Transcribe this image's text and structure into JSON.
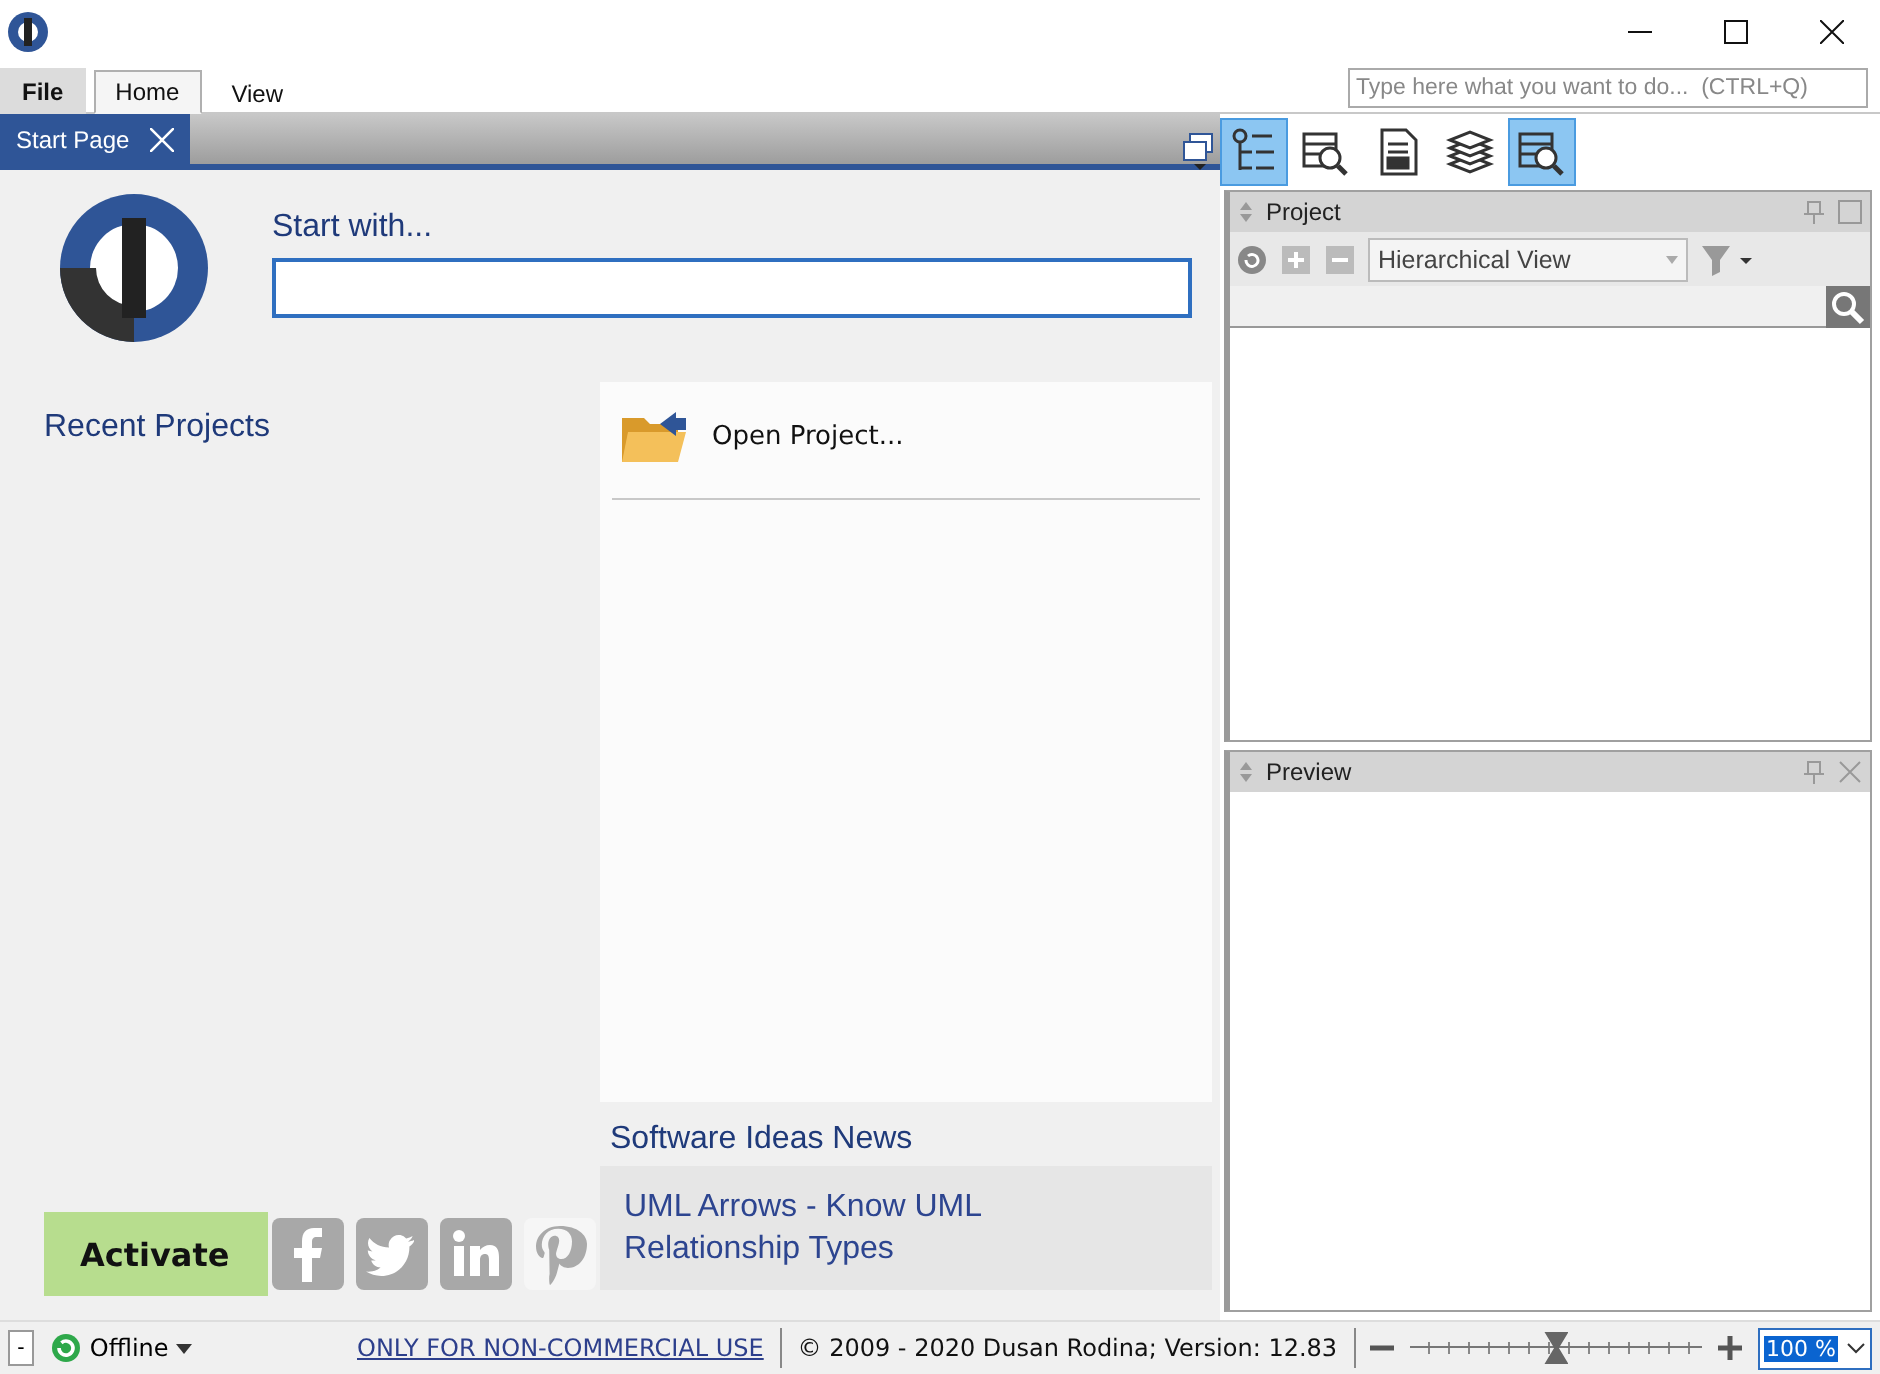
{
  "ribbon": {
    "tabs": [
      {
        "label": "File",
        "kind": "file",
        "selected": false
      },
      {
        "label": "Home",
        "kind": "tab",
        "selected": true
      },
      {
        "label": "View",
        "kind": "tab",
        "selected": false
      }
    ],
    "command_search": {
      "placeholder": "Type here what you want to do...  (CTRL+Q)"
    }
  },
  "document_tabs": [
    {
      "label": "Start Page",
      "selected": true
    }
  ],
  "panel_toolbar": [
    {
      "kind": "tree",
      "on": true
    },
    {
      "kind": "inspect",
      "on": false
    },
    {
      "kind": "document",
      "on": false
    },
    {
      "kind": "layers",
      "on": false
    },
    {
      "kind": "inspect",
      "on": true
    }
  ],
  "start_page": {
    "start_with": {
      "label": "Start with..."
    },
    "recent_projects": {
      "title": "Recent Projects"
    },
    "actions": [
      {
        "label": "Open Project..."
      }
    ],
    "news": {
      "title": "Software Ideas News",
      "items": [
        "UML Arrows - Know UML Relationship Types"
      ]
    },
    "activate": {
      "label": "Activate"
    },
    "social": [
      {
        "kind": "facebook"
      },
      {
        "kind": "twitter"
      },
      {
        "kind": "linkedin"
      },
      {
        "kind": "pinterest"
      }
    ]
  },
  "project_panel": {
    "title": "Project",
    "view": "Hierarchical View"
  },
  "preview_panel": {
    "title": "Preview"
  },
  "status_bar": {
    "collapse": "-",
    "connection": "Offline",
    "license": "ONLY FOR NON-COMMERCIAL USE",
    "copyright": "© 2009 - 2020 Dusan Rodina; Version: 12.83",
    "zoom": {
      "level": 0.5,
      "value": "100 %"
    }
  }
}
